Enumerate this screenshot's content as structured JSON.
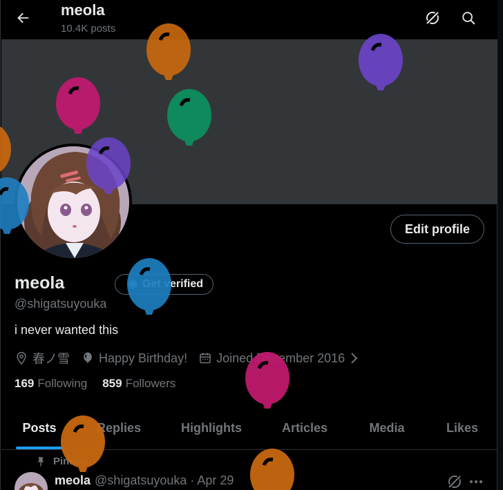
{
  "header": {
    "title": "meola",
    "posts_count": "10.4K posts"
  },
  "profile": {
    "name": "meola",
    "handle": "@shigatsuyouka",
    "bio": "i never wanted this",
    "edit_label": "Edit profile",
    "verify_label": "Get verified",
    "location": "春ノ雪",
    "birthday": "Happy Birthday!",
    "joined": "Joined December 2016",
    "following_count": "169",
    "following_label": "Following",
    "followers_count": "859",
    "followers_label": "Followers"
  },
  "tabs": [
    {
      "label": "Posts"
    },
    {
      "label": "Replies"
    },
    {
      "label": "Highlights"
    },
    {
      "label": "Articles"
    },
    {
      "label": "Media"
    },
    {
      "label": "Likes"
    }
  ],
  "post": {
    "pinned_label": "Pinned",
    "author": "meola",
    "meta": "@shigatsuyouka · Apr 29"
  },
  "colors": {
    "accent": "#1d9bf0",
    "banner": "#333639",
    "balloon_orange": "#c8680f",
    "balloon_purple": "#6b44c9",
    "balloon_magenta": "#c01a6e",
    "balloon_green": "#0d8f5e",
    "balloon_blue": "#1e7fc0"
  }
}
